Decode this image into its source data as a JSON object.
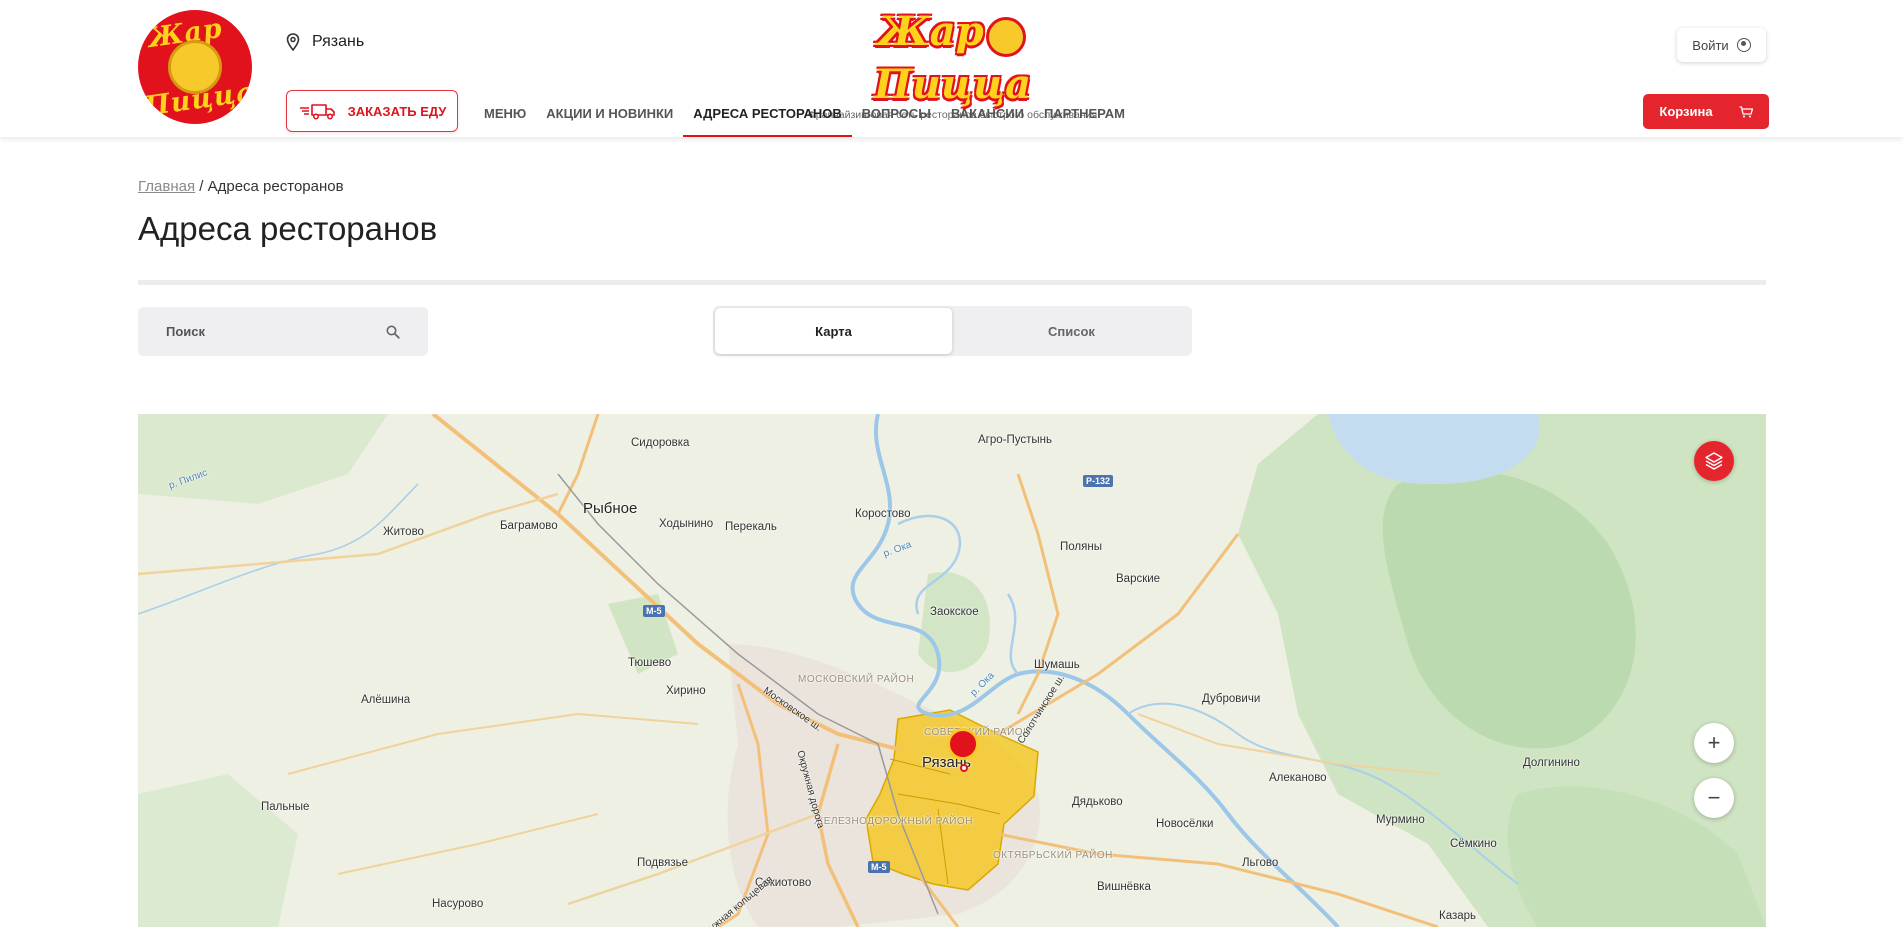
{
  "header": {
    "logo_top": "Жар",
    "logo_bottom": "Пицца",
    "city": "Рязань",
    "brand_word1": "Жар",
    "brand_word2": "Пицца",
    "brand_tagline": "Франчайзинговая сеть ресторанов быстрого обслуживания",
    "login_label": "Войти",
    "order_label": "ЗАКАЗАТЬ ЕДУ",
    "cart_label": "Корзина",
    "nav": [
      {
        "label": "МЕНЮ",
        "active": false
      },
      {
        "label": "АКЦИИ И НОВИНКИ",
        "active": false
      },
      {
        "label": "АДРЕСА РЕСТОРАНОВ",
        "active": true
      },
      {
        "label": "ВОПРОСЫ",
        "active": false
      },
      {
        "label": "ВАКАНСИИ",
        "active": false
      },
      {
        "label": "ПАРТНЕРАМ",
        "active": false
      }
    ]
  },
  "breadcrumb": {
    "home": "Главная",
    "separator": "/",
    "current": "Адреса ресторанов"
  },
  "page_title": "Адреса ресторанов",
  "search": {
    "placeholder": "Поиск"
  },
  "view_toggle": {
    "map": "Карта",
    "list": "Список",
    "selected": "Карта"
  },
  "map": {
    "places": [
      "Сидоровка",
      "Агро-Пустынь",
      "Рыбное",
      "Житово",
      "Баграмово",
      "Ходынино",
      "Перекаль",
      "Коростово",
      "Поляны",
      "Варские",
      "Заокское",
      "Тюшево",
      "Хирино",
      "Шумашь",
      "Дубровичи",
      "Алёшина",
      "Пальные",
      "Подвязье",
      "Насурово",
      "Секиотово",
      "Рязань",
      "Дядьково",
      "Новосёлки",
      "Алеканово",
      "Долгинино",
      "Мурмино",
      "Сёмкино",
      "Льгово",
      "Вишнёвка",
      "Казарь"
    ],
    "districts": [
      "МОСКОВСКИЙ РАЙОН",
      "СОВЕТСКИЙ РАЙОН",
      "ЖЕЛЕЗНОДОРОЖНЫЙ РАЙОН",
      "ОКТЯБРЬСКИЙ РАЙОН"
    ],
    "roads": [
      "Р-132",
      "М-5",
      "М-5"
    ],
    "streets": [
      "Московское ш.",
      "Солотчинское ш.",
      "Окружная дорога",
      "Окружная кольцевая"
    ],
    "rivers": [
      "р. Пилис",
      "р. Ока",
      "р. Ока"
    ],
    "zoom_in": "+",
    "zoom_out": "−",
    "accent_color": "#e5252d",
    "zone_color": "#f5c518"
  }
}
